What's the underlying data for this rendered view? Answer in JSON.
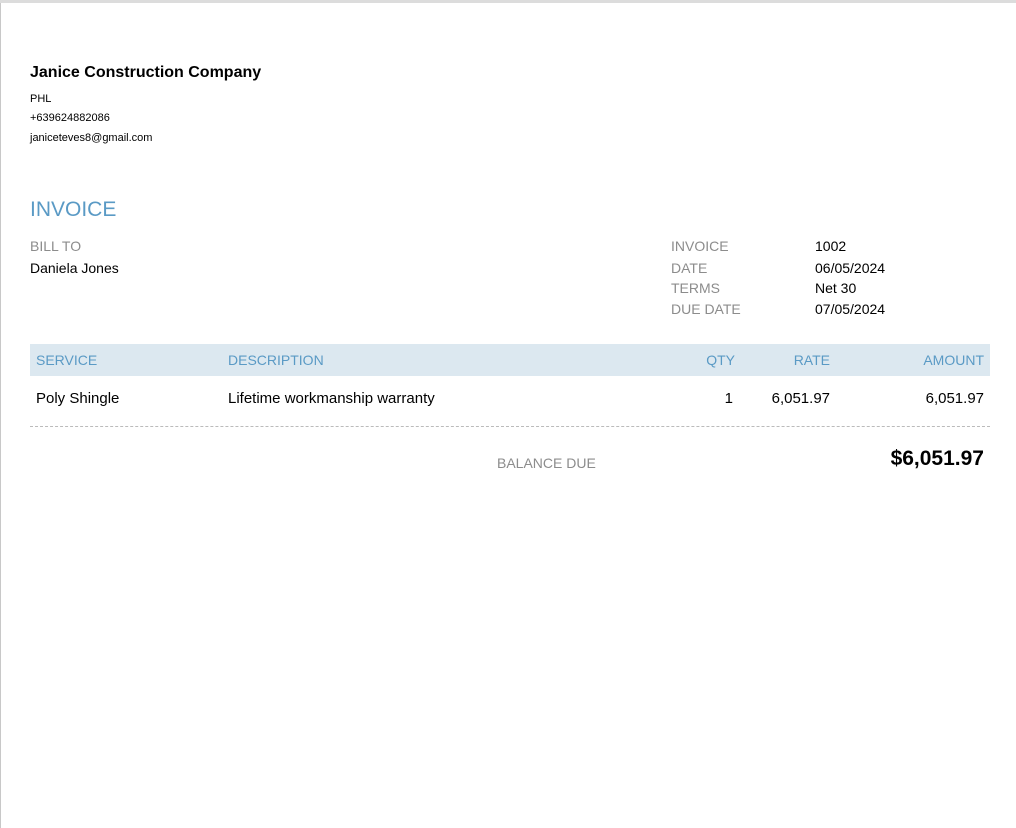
{
  "company": {
    "name": "Janice Construction Company",
    "location": "PHL",
    "phone": "+639624882086",
    "email": "janiceteves8@gmail.com"
  },
  "title": "INVOICE",
  "bill_to": {
    "label": "BILL TO",
    "name": "Daniela Jones"
  },
  "meta": [
    {
      "label": "INVOICE",
      "value": "1002"
    },
    {
      "label": "DATE",
      "value": "06/05/2024"
    },
    {
      "label": "TERMS",
      "value": "Net 30"
    },
    {
      "label": "DUE DATE",
      "value": "07/05/2024"
    }
  ],
  "table": {
    "headers": {
      "service": "SERVICE",
      "description": "DESCRIPTION",
      "qty": "QTY",
      "rate": "RATE",
      "amount": "AMOUNT"
    },
    "rows": [
      {
        "service": "Poly Shingle",
        "description": "Lifetime workmanship warranty",
        "qty": "1",
        "rate": "6,051.97",
        "amount": "6,051.97"
      }
    ]
  },
  "balance": {
    "label": "BALANCE DUE",
    "value": "$6,051.97"
  },
  "colors": {
    "accent": "#5a9ac5",
    "header_bg": "#dce8f0",
    "label": "#8c8c8c"
  }
}
